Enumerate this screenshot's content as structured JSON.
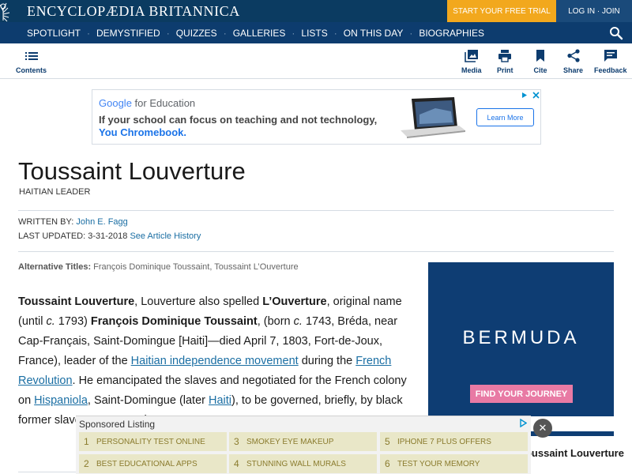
{
  "header": {
    "logo_text": "ENCYCLOPÆDIA BRITANNICA",
    "trial_label": "START YOUR FREE TRIAL",
    "login_label": "LOG IN · JOIN",
    "colors": {
      "top": "#0b3b61",
      "nav": "#0d3c6e",
      "trial": "#f2a81d"
    }
  },
  "nav": {
    "items": [
      "SPOTLIGHT",
      "DEMYSTIFIED",
      "QUIZZES",
      "GALLERIES",
      "LISTS",
      "ON THIS DAY",
      "BIOGRAPHIES"
    ],
    "separator": "·",
    "search_icon": "search-icon"
  },
  "toolbar": {
    "contents_label": "Contents",
    "media_label": "Media",
    "print_label": "Print",
    "cite_label": "Cite",
    "share_label": "Share",
    "feedback_label": "Feedback"
  },
  "ad_top": {
    "brand_google": "Google",
    "brand_suffix": "for Education",
    "line1": "If your school can focus on teaching and not technology,",
    "line2": "You Chromebook.",
    "cta": "Learn More",
    "choices_icon": "ad-choices-icon"
  },
  "article": {
    "title": "Toussaint Louverture",
    "subtitle": "HAITIAN LEADER",
    "written_by_label": "WRITTEN BY:",
    "author": "John E. Fagg",
    "updated_label": "LAST UPDATED:",
    "updated_date": "3-31-2018",
    "history_link": "See Article History",
    "alt_label": "Alternative Titles:",
    "alt_titles": "François Dominique Toussaint, Toussaint L’Ouverture",
    "p": {
      "s1_bold": "Toussaint Louverture",
      "s2": ", Louverture also spelled ",
      "s3_bold": "L’Ouverture",
      "s4": ", original name (until ",
      "s5_ital": "c.",
      "s6": " 1793) ",
      "s7_bold": "François Dominique Toussaint",
      "s8": ", (born ",
      "s9_ital": "c.",
      "s10": " 1743, Bréda, near Cap-Français, Saint-Domingue [Haiti]—died April 7, 1803, Fort-de-Joux, France), leader of the ",
      "link1": "Haitian independence movement",
      "s11": " during the ",
      "link2": "French Revolution",
      "s12": ". He emancipated the slaves and negotiated for the French colony on ",
      "link3": "Hispaniola",
      "s13": ", Saint-Domingue (later ",
      "link4": "Haiti",
      "s14": "), to be governed, briefly, by black former slaves as a French protectorate."
    }
  },
  "ad_right": {
    "brand": "BERMUDA",
    "cta": "FIND YOUR JOURNEY",
    "bg": "#0e3d73",
    "cta_color": "#e87aa4"
  },
  "right_box": {
    "text": "Toussaint Louverture"
  },
  "sponsored": {
    "title": "Sponsored Listing",
    "items": [
      {
        "num": "1",
        "label": "PERSONALITY TEST ONLINE"
      },
      {
        "num": "3",
        "label": "SMOKEY EYE MAKEUP"
      },
      {
        "num": "5",
        "label": "IPHONE 7 PLUS OFFERS"
      },
      {
        "num": "2",
        "label": "BEST EDUCATIONAL APPS"
      },
      {
        "num": "4",
        "label": "STUNNING WALL MURALS"
      },
      {
        "num": "6",
        "label": "TEST YOUR MEMORY"
      }
    ],
    "close_glyph": "✕"
  }
}
